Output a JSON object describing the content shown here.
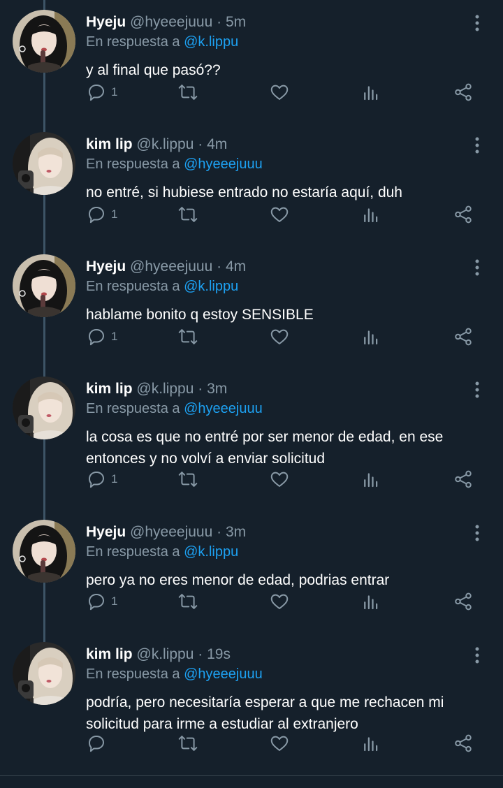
{
  "reply_prefix": "En respuesta a",
  "tweets": [
    {
      "name": "Hyeju",
      "handle": "@hyeeejuuu",
      "sep": "·",
      "time": "5m",
      "reply_to": "@k.lippu",
      "lines": [
        "y al final que pasó??",
        ""
      ],
      "reply_count": "1",
      "avatar": "hyeju-avatar"
    },
    {
      "name": "kim lip",
      "handle": "@k.lippu",
      "sep": "·",
      "time": "4m",
      "reply_to": "@hyeeejuuu",
      "lines": [
        "no entré, si hubiese entrado no estaría aquí, duh",
        ""
      ],
      "reply_count": "1",
      "avatar": "kimlip-avatar"
    },
    {
      "name": "Hyeju",
      "handle": "@hyeeejuuu",
      "sep": "·",
      "time": "4m",
      "reply_to": "@k.lippu",
      "lines": [
        "hablame bonito q estoy SENSIBLE",
        ""
      ],
      "reply_count": "1",
      "avatar": "hyeju-avatar"
    },
    {
      "name": "kim lip",
      "handle": "@k.lippu",
      "sep": "·",
      "time": "3m",
      "reply_to": "@hyeeejuuu",
      "lines": [
        "la cosa es que no entré por ser menor de edad, en ese",
        "entonces y no volví a enviar solicitud"
      ],
      "reply_count": "1",
      "avatar": "kimlip-avatar"
    },
    {
      "name": "Hyeju",
      "handle": "@hyeeejuuu",
      "sep": "·",
      "time": "3m",
      "reply_to": "@k.lippu",
      "lines": [
        "pero ya no eres menor de edad, podrias entrar",
        ""
      ],
      "reply_count": "1",
      "avatar": "hyeju-avatar"
    },
    {
      "name": "kim lip",
      "handle": "@k.lippu",
      "sep": "·",
      "time": "19s",
      "reply_to": "@hyeeejuuu",
      "lines": [
        "podría, pero necesitaría esperar a que me rechacen mi",
        "solicitud para irme a estudiar al extranjero"
      ],
      "reply_count": "",
      "avatar": "kimlip-avatar"
    }
  ],
  "icons": {
    "reply": "reply-icon",
    "retweet": "retweet-icon",
    "like": "heart-icon",
    "stats": "analytics-icon",
    "share": "share-icon",
    "more": "more-vertical-icon"
  },
  "colors": {
    "background": "#15202b",
    "text": "#ffffff",
    "secondary": "#8899a6",
    "mention": "#1da1f2",
    "thread_line": "#3d5466"
  }
}
